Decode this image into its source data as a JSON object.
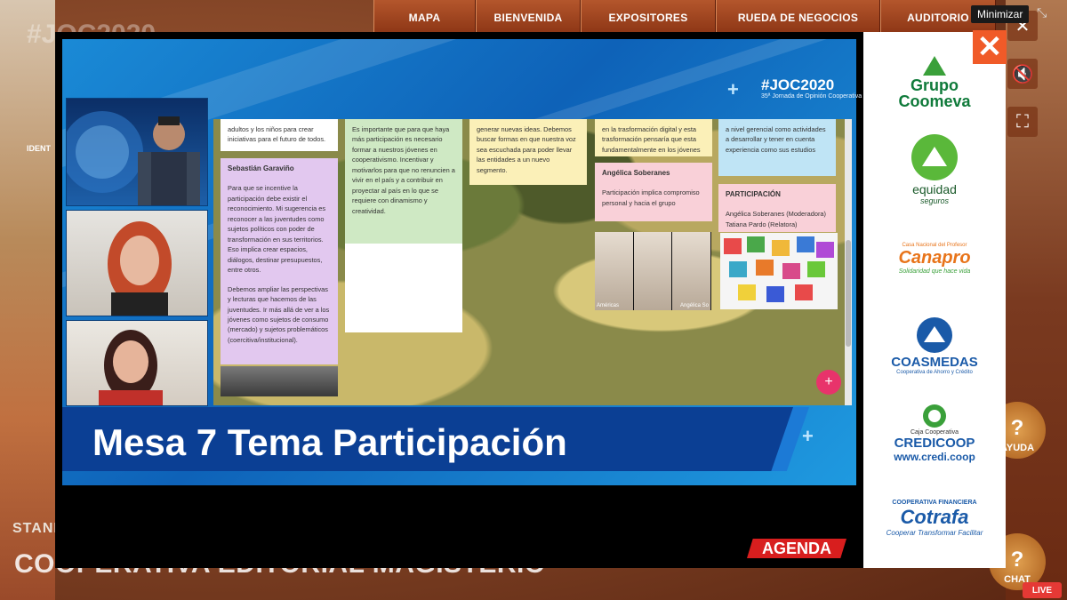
{
  "background": {
    "nav": [
      "MAPA",
      "BIENVENIDA",
      "EXPOSITORES",
      "RUEDA DE NEGOCIOS",
      "AUDITORIO"
    ],
    "ghost_title": "#JOC2020",
    "left_label": "IDENT",
    "stand_label": "STAND",
    "exhibitor_name": "COOPERATIVA EDITORIAL MAGISTERIO",
    "help_label": "AYUDA",
    "chat_label": "CHAT",
    "live_label": "LIVE",
    "minimize_tooltip": "Minimizar"
  },
  "video": {
    "event_tag": "#JOC2020",
    "event_sub": "35ª Jornada de Opinión Cooperativa",
    "lower_third_title": "Mesa 7 Tema Participación",
    "agenda_label": "AGENDA",
    "board": {
      "col1_top_text": "adultos y los niños para crear iniciativas para el futuro de todos.",
      "col1_note_title": "Sebastián Garaviño",
      "col1_note_body": "Para que se incentive la participación debe existir el reconocimiento. Mi sugerencia es reconocer a las juventudes como sujetos políticos con poder de transformación en sus territorios. Eso implica crear espacios, diálogos, destinar presupuestos, entre otros.",
      "col1_note_body2": "Debemos ampliar las perspectivas y lecturas que hacemos de las juventudes. Ir más allá de ver a los jóvenes como sujetos de consumo (mercado) y sujetos problemáticos (coercitiva/institucional).",
      "col2_text": "Es importante que para que haya más participación es necesario formar a nuestros jóvenes en cooperativismo. Incentivar y motivarlos para que no renuncien a vivir en el país y a contribuir en proyectar al país en lo que se requiere con dinamismo y creatividad.",
      "col3_text": "generar nuevas ideas. Debemos buscar formas en que nuestra voz sea escuchada para poder llevar las entidades a un nuevo segmento.",
      "col4_top_text": "en la trasformación digital y esta trasformación pensaría que esta fundamentalmente en los jóvenes",
      "col4_note_title": "Angélica Soberanes",
      "col4_note_body": "Participación implica compromiso personal y hacia el grupo",
      "zoom_name_a": "Américas",
      "zoom_name_b": "Angélica So",
      "col5_top_text": "a nivel gerencial como actividades a desarrollar y tener en cuenta experiencia como sus estudios",
      "col5_note_title": "PARTICIPACIÓN",
      "col5_note_body": "Angélica Soberanes (Moderadora) Tatiana Pardo (Relatora)"
    }
  },
  "sponsors": [
    {
      "name": "Grupo Coomeva",
      "line1": "Grupo",
      "line2": "Coomeva",
      "color": "#0f7a3a"
    },
    {
      "name": "equidad seguros",
      "line1": "equidad",
      "line2": "seguros",
      "color": "#3aa03a"
    },
    {
      "name": "Canapro",
      "line1": "Casa Nacional del Profesor",
      "line2": "Canapro",
      "line3": "Solidaridad que hace vida",
      "color": "#e8741a"
    },
    {
      "name": "COASMEDAS",
      "line1": "COASMEDAS",
      "line2": "Cooperativa de Ahorro y Crédito",
      "color": "#1a5aa8"
    },
    {
      "name": "CREDICOOP",
      "line1": "Caja Cooperativa",
      "line2": "CREDICOOP",
      "line3": "www.credi.coop",
      "color": "#1a5aa8"
    },
    {
      "name": "Cotrafa",
      "line1": "COOPERATIVA FINANCIERA",
      "line2": "Cotrafa",
      "line3": "Cooperar  Transformar  Facilitar",
      "color": "#1a5aa8"
    }
  ],
  "colors": {
    "accent": "#f05a28",
    "lower_third": "#0b3f94",
    "agenda": "#d81e1e",
    "fab": "#e8336b"
  }
}
